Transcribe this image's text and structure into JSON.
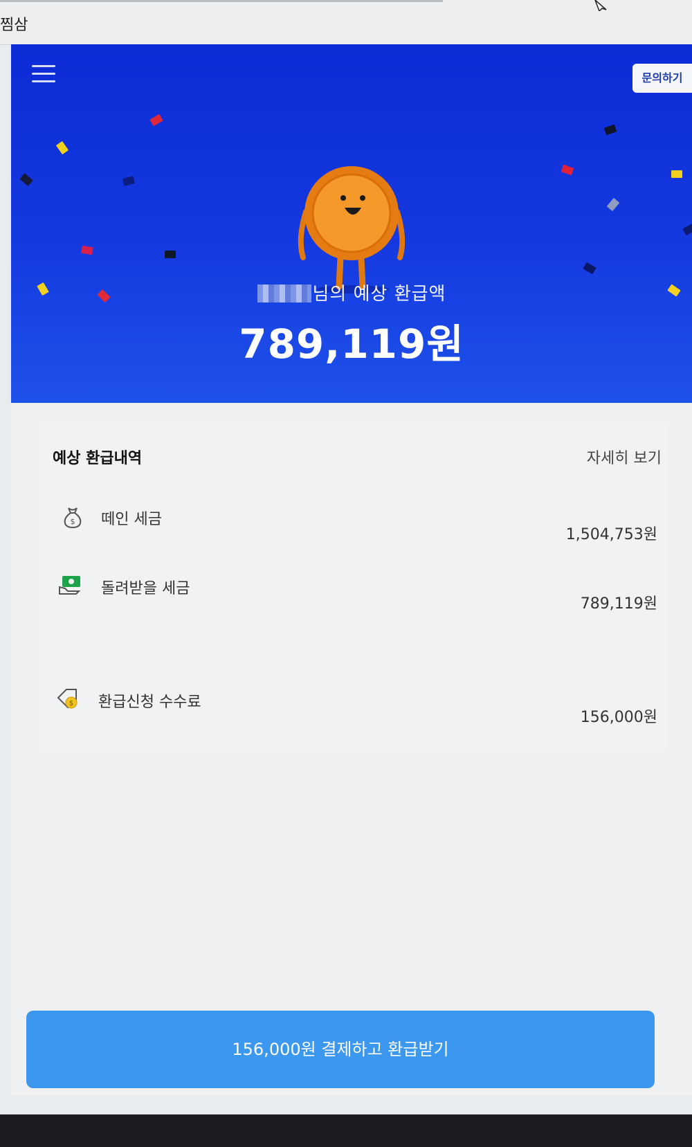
{
  "tab": {
    "title": "찜삼"
  },
  "header": {
    "menu_icon": "hamburger-menu-icon",
    "inquiry_label": "문의하기"
  },
  "hero": {
    "label_suffix": "님의 예상 환급액",
    "amount": "789,119원",
    "mascot": "coin-mascot"
  },
  "summary": {
    "title": "예상 환급내역",
    "detail_link": "자세히 보기",
    "rows": [
      {
        "icon": "money-bag-icon",
        "label": "떼인 세금",
        "value": "1,504,753원"
      },
      {
        "icon": "cash-hand-icon",
        "label": "돌려받을 세금",
        "value": "789,119원"
      },
      {
        "icon": "price-tag-coin-icon",
        "label": "환급신청 수수료",
        "value": "156,000원"
      }
    ]
  },
  "cta": {
    "label": "156,000원 결제하고 환급받기"
  },
  "colors": {
    "hero_blue": "#1439e0",
    "cta_blue": "#3c97ee",
    "coin_orange": "#f08a1c"
  }
}
